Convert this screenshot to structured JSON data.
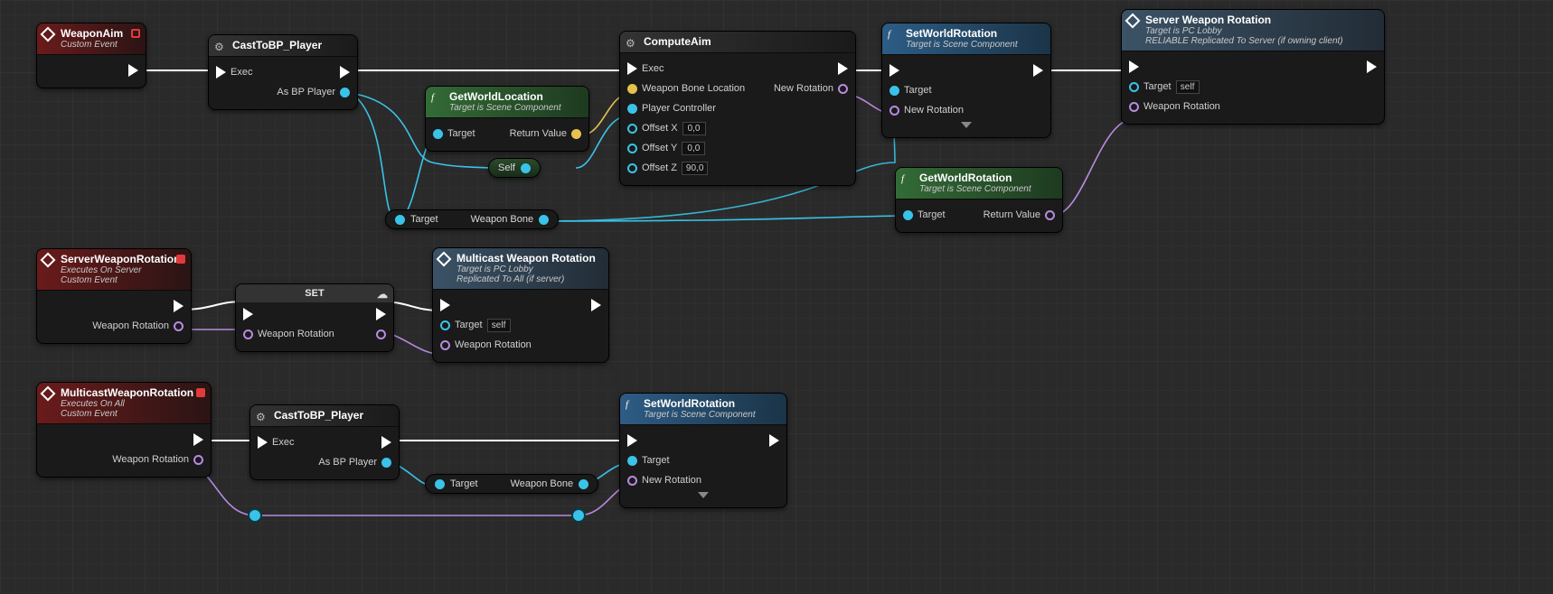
{
  "events": {
    "weaponAim": {
      "title": "WeaponAim",
      "subtitle": "Custom Event"
    },
    "serverWeaponRotationEvt": {
      "title": "ServerWeaponRotation",
      "subtitle1": "Executes On Server",
      "subtitle2": "Custom Event",
      "out_weaponRotation": "Weapon Rotation"
    },
    "multicastWeaponRotationEvt": {
      "title": "MulticastWeaponRotation",
      "subtitle1": "Executes On All",
      "subtitle2": "Custom Event",
      "out_weaponRotation": "Weapon Rotation"
    }
  },
  "cast1": {
    "title": "CastToBP_Player",
    "exec": "Exec",
    "out": "As BP Player"
  },
  "cast2": {
    "title": "CastToBP_Player",
    "exec": "Exec",
    "out": "As BP Player"
  },
  "getWorldLoc": {
    "title": "GetWorldLocation",
    "subtitle": "Target is Scene Component",
    "target": "Target",
    "return": "Return Value"
  },
  "getWorldRot": {
    "title": "GetWorldRotation",
    "subtitle": "Target is Scene Component",
    "target": "Target",
    "return": "Return Value"
  },
  "self": "Self",
  "weaponBone1": {
    "target": "Target",
    "name": "Weapon Bone"
  },
  "weaponBone2": {
    "target": "Target",
    "name": "Weapon Bone"
  },
  "computeAim": {
    "title": "ComputeAim",
    "exec": "Exec",
    "in_wbl": "Weapon Bone Location",
    "in_pc": "Player Controller",
    "in_ox": "Offset X",
    "in_oy": "Offset Y",
    "in_oz": "Offset Z",
    "v_ox": "0,0",
    "v_oy": "0,0",
    "v_oz": "90,0",
    "out_newRot": "New Rotation"
  },
  "setWorldRot1": {
    "title": "SetWorldRotation",
    "subtitle": "Target is Scene Component",
    "in_target": "Target",
    "in_newRot": "New Rotation"
  },
  "setWorldRot2": {
    "title": "SetWorldRotation",
    "subtitle": "Target is Scene Component",
    "in_target": "Target",
    "in_newRot": "New Rotation"
  },
  "serverWeaponRotCall": {
    "title": "Server Weapon Rotation",
    "subtitle1": "Target is PC Lobby",
    "subtitle2": "RELIABLE Replicated To Server (if owning client)",
    "in_target": "Target",
    "v_target": "self",
    "in_wr": "Weapon Rotation"
  },
  "multicastCall": {
    "title": "Multicast Weapon Rotation",
    "subtitle1": "Target is PC Lobby",
    "subtitle2": "Replicated To All (if server)",
    "in_target": "Target",
    "v_target": "self",
    "in_wr": "Weapon Rotation"
  },
  "setNode": {
    "title": "SET",
    "pin": "Weapon Rotation"
  }
}
